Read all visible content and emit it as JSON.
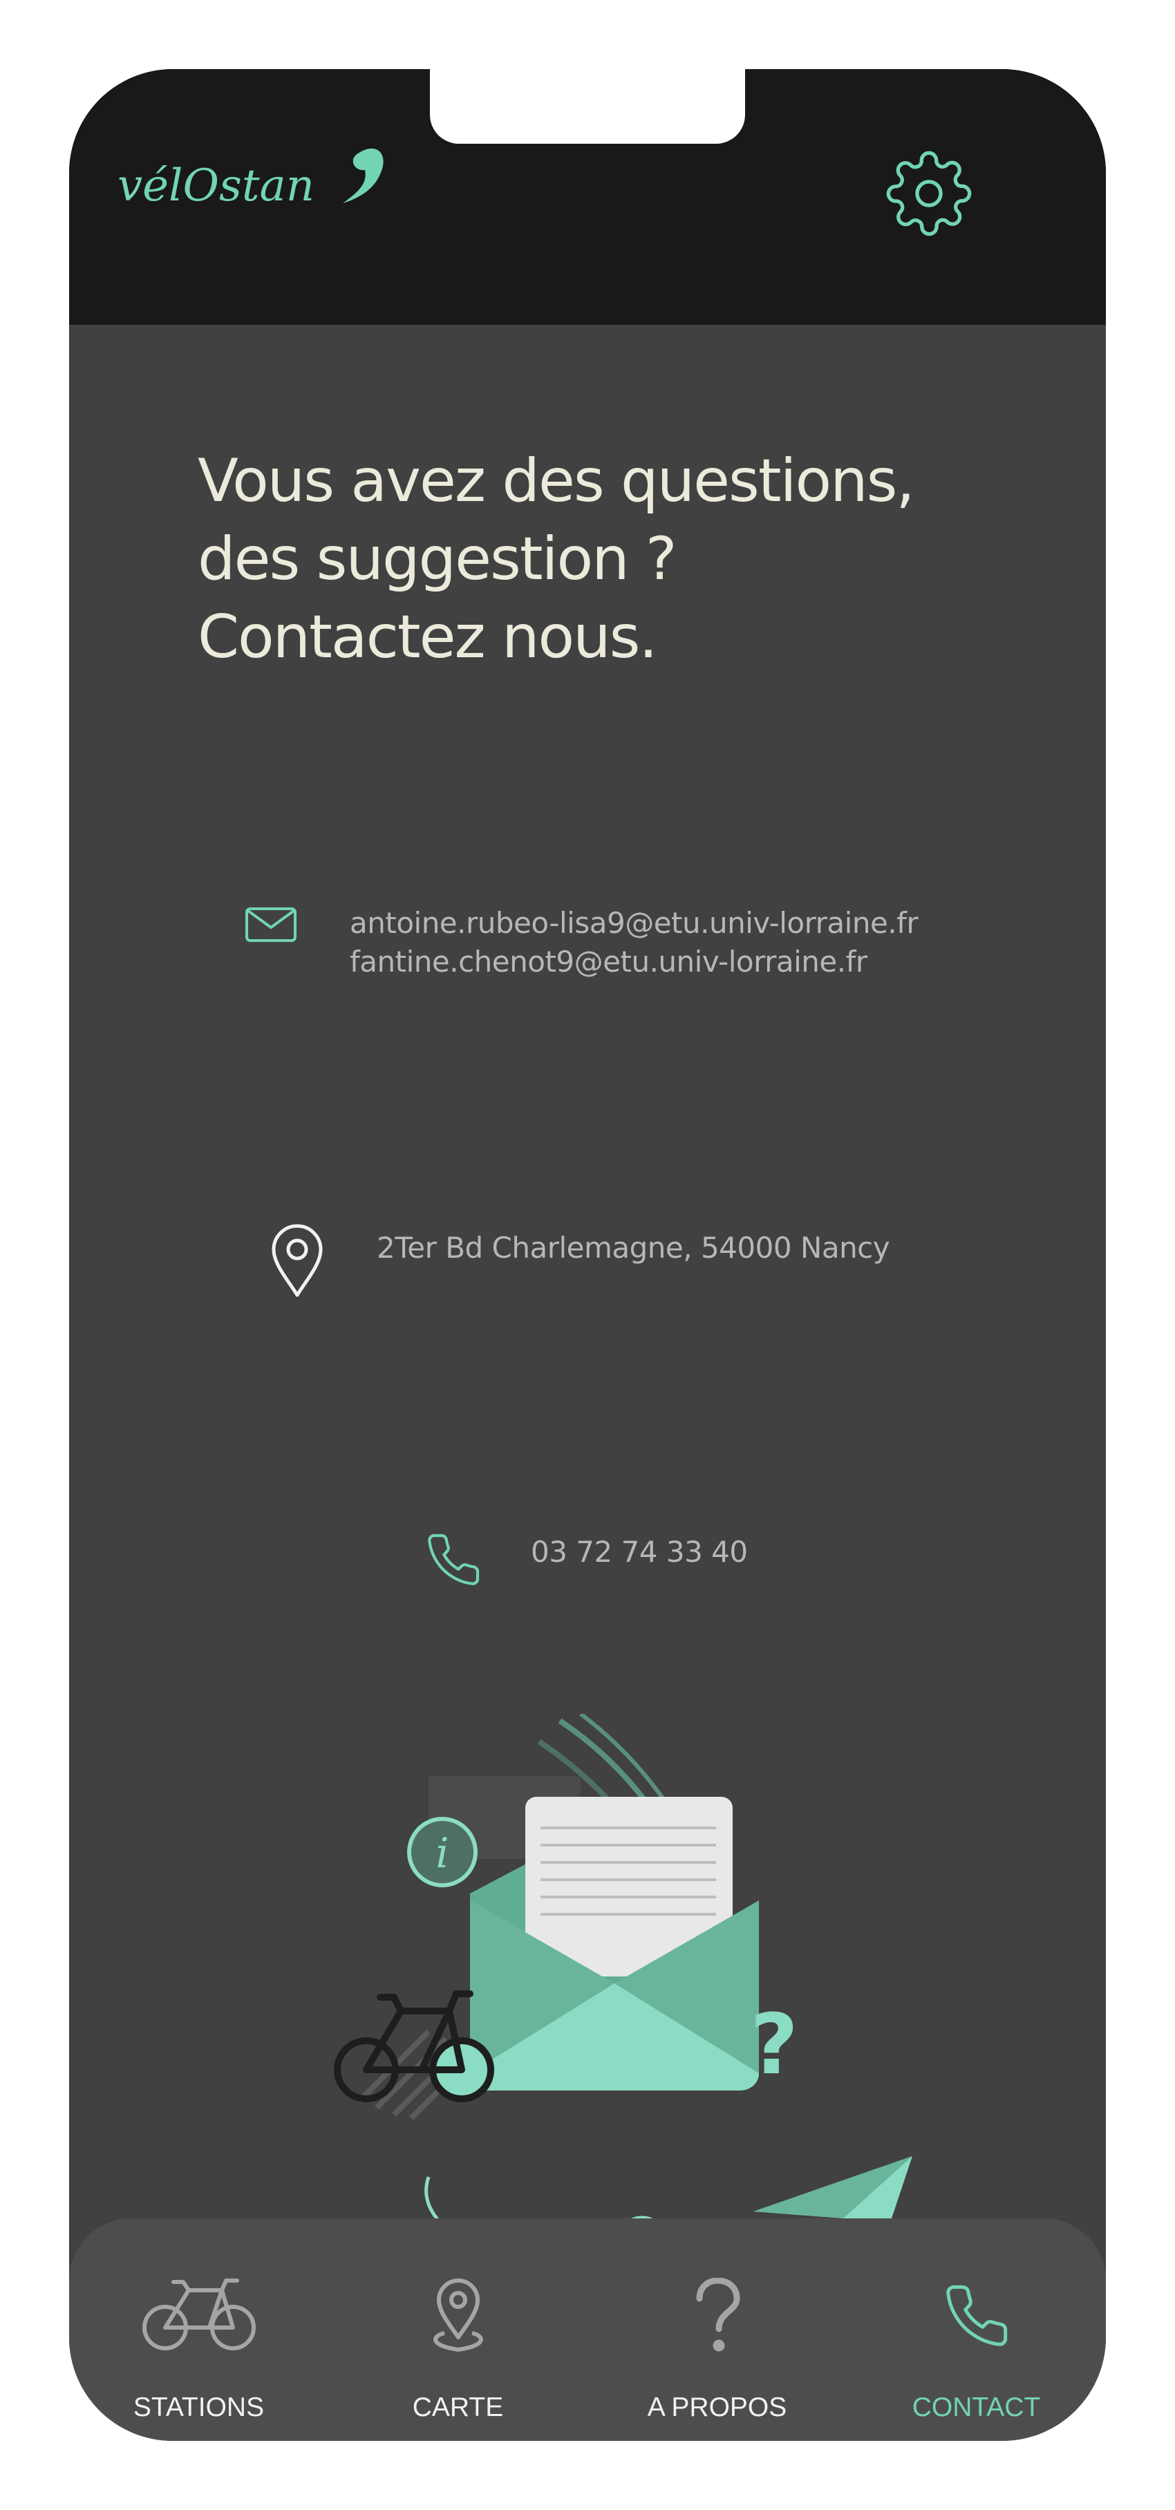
{
  "header": {
    "logo_text": "vélOstan",
    "settings_icon": "gear-icon"
  },
  "main": {
    "title_lines": [
      "Vous avez des questions,",
      "des suggestion ?",
      "Contactez nous."
    ],
    "contact": {
      "emails": [
        "antoine.rubeo-lisa9@etu.univ-lorraine.fr",
        "fantine.chenot9@etu.univ-lorraine.fr"
      ],
      "email_icon": "envelope-icon",
      "address": "2Ter Bd Charlemagne, 54000 Nancy",
      "address_icon": "map-pin-icon",
      "phone": "03 72 74 33 40",
      "phone_icon": "phone-icon"
    }
  },
  "nav": {
    "items": [
      {
        "label": "STATIONS",
        "icon": "bicycle-icon",
        "active": false
      },
      {
        "label": "CARTE",
        "icon": "map-pin-icon",
        "active": false
      },
      {
        "label": "A PROPOS",
        "icon": "question-mark-icon",
        "active": false
      },
      {
        "label": "CONTACT",
        "icon": "phone-icon",
        "active": true
      }
    ]
  },
  "colors": {
    "accent": "#72d4b4",
    "header_bg": "#191919",
    "page_bg": "#414141",
    "navbar_bg": "#4d4e4b",
    "title_text": "#eceadb",
    "body_text": "#b7b7b7"
  }
}
